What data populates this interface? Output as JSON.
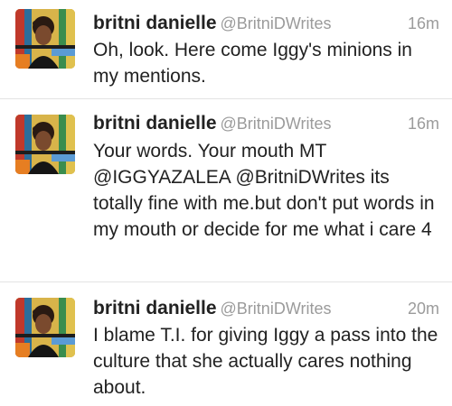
{
  "tweets": [
    {
      "name": "britni danielle",
      "handle": "@BritniDWrites",
      "time": "16m",
      "text": "Oh, look. Here come Iggy's minions in my mentions."
    },
    {
      "name": "britni danielle",
      "handle": "@BritniDWrites",
      "time": "16m",
      "text": "Your words. Your mouth MT @IGGYAZALEA @BritniDWrites its totally fine with me.but don't put words in my mouth or decide for me what i care 4"
    },
    {
      "name": "britni danielle",
      "handle": "@BritniDWrites",
      "time": "20m",
      "text": "I blame T.I. for giving Iggy a pass into the culture that she actually cares nothing about."
    }
  ],
  "colors": {
    "name": "#222222",
    "handle": "#9b9b9b",
    "divider": "#e3e3e3"
  }
}
